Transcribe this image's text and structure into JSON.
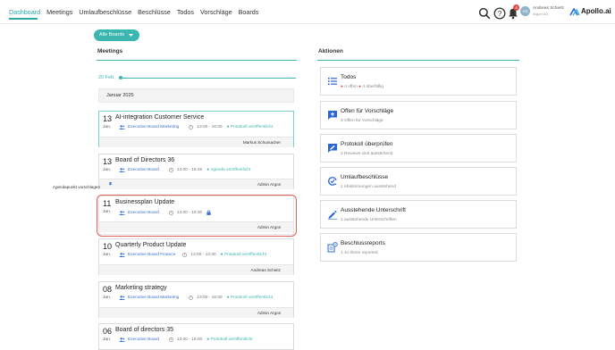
{
  "nav": {
    "items": [
      "Dashboard",
      "Meetings",
      "Umlaufbeschlüsse",
      "Beschlüsse",
      "Todos",
      "Vorschläge",
      "Boards"
    ],
    "active": "Dashboard"
  },
  "topbar": {
    "notification_count": "4",
    "avatar_initials": "AS",
    "user_name": "Andreas Schietz",
    "user_org": "Argon AG",
    "logo": "Apollo.ai"
  },
  "filter": {
    "boards_label": "Alle Boards"
  },
  "meetings": {
    "title": "Meetings",
    "timeline_label": "20 Feb.",
    "month": "Januar 2025",
    "items": [
      {
        "day": "13",
        "month": "Jan.",
        "title": "AI-integration Customer Service",
        "board": "Executive Board Marketing",
        "time": "13:00 - 16:30",
        "status": "Protokoll veröffentlicht",
        "footer": "Markus Schumacher",
        "agenda": ""
      },
      {
        "day": "13",
        "month": "Jan.",
        "title": "Board of Directors 36",
        "board": "Executive Board",
        "time": "13:00 - 16:45",
        "status": "Agenda veröffentlicht",
        "footer": "Admin Argos",
        "agenda": "Agendapunkt vorschlagen"
      },
      {
        "day": "11",
        "month": "Jan.",
        "title": "Businessplan Update",
        "board": "Executive Board",
        "time": "13:00 - 18:30",
        "status": "",
        "footer": "Admin Argos",
        "agenda": ""
      },
      {
        "day": "10",
        "month": "Jan.",
        "title": "Quarterly Product Update",
        "board": "Executive Board Finance",
        "time": "13:00 - 13:30",
        "status": "Protokoll veröffentlicht",
        "footer": "Andreas Schietz",
        "agenda": ""
      },
      {
        "day": "08",
        "month": "Jan.",
        "title": "Marketing strategy",
        "board": "Executive Board Marketing",
        "time": "13:00 - 19:30",
        "status": "Protokoll veröffentlicht",
        "footer": "Admin Argos",
        "agenda": ""
      },
      {
        "day": "06",
        "month": "Jan.",
        "title": "Board of directors 35",
        "board": "Executive Board",
        "time": "13:00 - 16:00",
        "status": "Protokoll veröffentlicht",
        "footer": "",
        "agenda": ""
      }
    ]
  },
  "aktionen": {
    "title": "Aktionen",
    "items": [
      {
        "title": "Todos",
        "sub": "4 offen",
        "sub2": "4 überfällig",
        "icon": "list-icon"
      },
      {
        "title": "Offen für Vorschläge",
        "sub": "3 Offen für Vorschläge",
        "icon": "suggestion-icon"
      },
      {
        "title": "Protokoll überprüfen",
        "sub": "2 Reviews sind ausstehend",
        "icon": "review-icon"
      },
      {
        "title": "Umlaufbeschlüsse",
        "sub": "1 Abstimmungen ausstehend",
        "icon": "circular-vote-icon"
      },
      {
        "title": "Ausstehende Unterschrift",
        "sub": "1 ausstehende Unterschriften",
        "icon": "signature-icon"
      },
      {
        "title": "Beschlussreports",
        "sub": "1 zu Ihnen reported",
        "icon": "report-icon"
      }
    ]
  },
  "colors": {
    "accent": "#3cb6b0",
    "link": "#3b6fd6",
    "highlight": "#e0605a"
  }
}
